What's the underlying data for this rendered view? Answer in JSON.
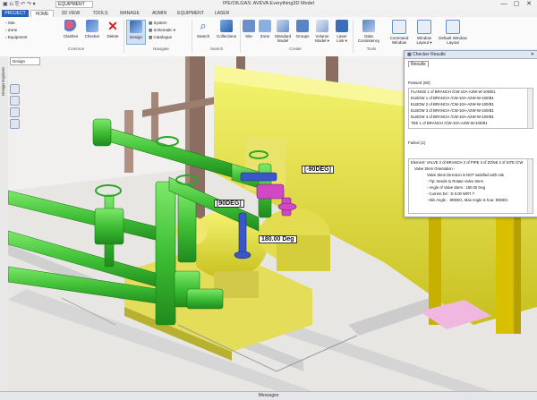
{
  "app": {
    "title": "IPE/OILGAS: AVEVA Everything3D Model",
    "workspace": "EQUIPMENT",
    "window_controls": [
      "—",
      "▢",
      "✕"
    ]
  },
  "tabs": [
    {
      "label": "PROJECT",
      "active": false
    },
    {
      "label": "HOME",
      "active": true
    },
    {
      "label": "3D VIEW",
      "active": false
    },
    {
      "label": "TOOLS",
      "active": false
    },
    {
      "label": "MANAGE",
      "active": false
    },
    {
      "label": "ADMIN",
      "active": false
    },
    {
      "label": "EQUIPMENT",
      "active": false
    },
    {
      "label": "LASER",
      "active": false
    }
  ],
  "ribbon": {
    "small_left": [
      "Site",
      "Zone",
      "Equipment"
    ],
    "clashes": "Clashes",
    "checker": "Checker",
    "delete": "Delete",
    "design": "Design",
    "system": "System",
    "schematic": "Schematic",
    "catalogue": "Catalogue",
    "search": "Search",
    "collections": "Collections",
    "site": "Site",
    "zone": "Zone",
    "standard_model": "Standard Model",
    "groups": "Groups",
    "volume_model": "Volume Model",
    "laser_link": "Laser Link",
    "data_consistency": "Data Consistency",
    "command_window": "Command Window",
    "window_layout": "Window Layout",
    "default_window_layout": "Default Window Layout",
    "groups_labels": [
      "Common",
      "Navigate",
      "Search",
      "Create",
      "Tools"
    ]
  },
  "left_panel": {
    "label": "Design Explorer"
  },
  "viewport": {
    "tab_label": "Design",
    "labels": [
      "[-90DEG]",
      "[90DEG]",
      "180.00 Deg"
    ]
  },
  "checker_results": {
    "title": "Checker Results",
    "tab": "Results",
    "passed_header": "Passed (60)",
    "passed": [
      "FLANGE 1 of BRANCH /CW-10A-A2W-W-100/B1",
      "ELBOW 1 of BRANCH /CW-10A-A2W-W-100/B1",
      "ELBOW 2 of BRANCH /CW-10A-A2W-W-100/B1",
      "ELBOW 3 of BRANCH /CW-10A-A2W-W-100/B1",
      "ELBOW 4 of BRANCH /CW-10A-A2W-W-100/B1",
      "TEE 1 of BRANCH /CW-10A-A2W-W-100/B1"
    ],
    "failed_header": "Failed (1)",
    "failed_detail": [
      "Element: VALVE 2 of BRANCH 2 of PIPE 3 of ZONE 2 of SITE /CW",
      "Valve Stem Orientation -",
      "Valve Stem Direction is NOT satisfied with rule",
      "- Tip: Needs to Rotate Valve Stem",
      "- Angle of Valve Stem : 180.00 Deg",
      "- Current Dir : D 0.00 WRT /*",
      "- Min Angle : -90DEG, Max Angle is N.ar. 90DEG"
    ]
  },
  "status": {
    "message": "Messages"
  }
}
